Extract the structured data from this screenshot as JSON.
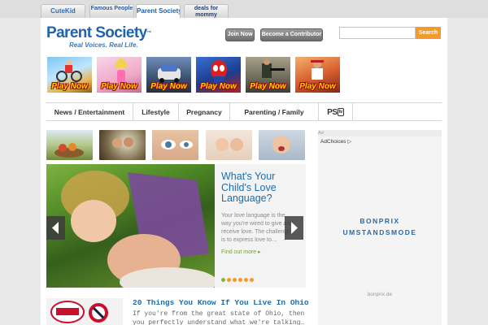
{
  "site_tabs": [
    {
      "label": "CuteKid"
    },
    {
      "label": "Famous People"
    },
    {
      "label": "Parent Society"
    },
    {
      "label": "deals for mommy"
    }
  ],
  "header": {
    "logo_name": "Parent Society",
    "logo_tagline": "Real Voices.  Real Life.",
    "join_label": "Join Now",
    "contributor_label": "Become a Contributor",
    "search_value": "",
    "search_button": "Search",
    "accent": "#f39a2b",
    "brand": "#1f64ad"
  },
  "games": [
    {
      "label": "Play Now",
      "icon": "game-thumb"
    },
    {
      "label": "Play Now",
      "icon": "game-thumb"
    },
    {
      "label": "Play Now",
      "icon": "game-thumb"
    },
    {
      "label": "Play Now",
      "icon": "game-thumb"
    },
    {
      "label": "Play Now",
      "icon": "game-thumb"
    },
    {
      "label": "Play Now",
      "icon": "game-thumb"
    }
  ],
  "nav": {
    "items": [
      "News / Entertainment",
      "Lifestyle",
      "Pregnancy",
      "Parenting / Family"
    ],
    "pstv": {
      "ps": "PS",
      "tv": "tv"
    }
  },
  "hero": {
    "title": "What's Your Child's Love Language?",
    "text": "Your love language is the way you're wired to give and receive love. The challenge is to express love to…",
    "link": "Find out more ▸",
    "active_slide": 1,
    "slide_count": 6
  },
  "article": {
    "title": "20 Things You Know If You Live In Ohio",
    "excerpt": "If you're from the great state of Ohio, then you perfectly understand what we're talking…"
  },
  "ad": {
    "label": "Ad",
    "adchoices": "AdChoices",
    "brand_line1": "BONPRIX",
    "brand_line2": "UMSTANDSMODE",
    "domain": "bonprix.de"
  }
}
